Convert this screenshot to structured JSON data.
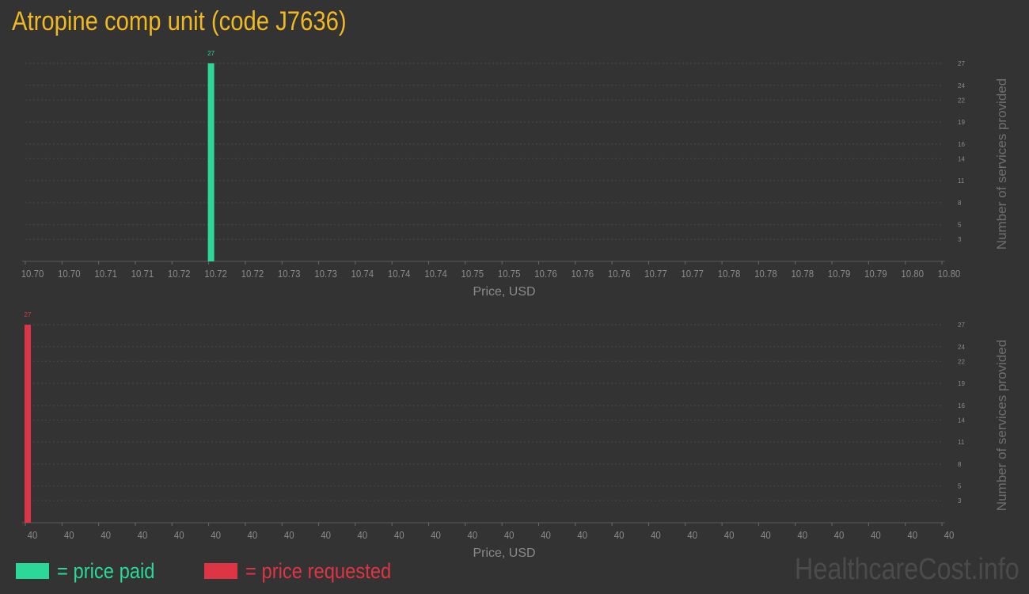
{
  "title": "Atropine comp unit (code J7636)",
  "colors": {
    "paid": "#2bd897",
    "requested": "#de3545",
    "title": "#f0b822",
    "grid": "#4a4a4a",
    "axis_text": "#8a8a8a",
    "background": "#333333"
  },
  "chart_data": [
    {
      "type": "bar",
      "name": "price paid chart",
      "categories": [
        "10.70",
        "10.70",
        "10.71",
        "10.71",
        "10.72",
        "10.72",
        "10.72",
        "10.73",
        "10.73",
        "10.74",
        "10.74",
        "10.74",
        "10.75",
        "10.75",
        "10.76",
        "10.76",
        "10.76",
        "10.77",
        "10.77",
        "10.78",
        "10.78",
        "10.78",
        "10.79",
        "10.79",
        "10.80",
        "10.80"
      ],
      "values": [
        0,
        0,
        0,
        0,
        0,
        27,
        0,
        0,
        0,
        0,
        0,
        0,
        0,
        0,
        0,
        0,
        0,
        0,
        0,
        0,
        0,
        0,
        0,
        0,
        0,
        0
      ],
      "data_labels": [
        {
          "index": 5,
          "text": "27"
        }
      ],
      "yticks": [
        "3",
        "5",
        "8",
        "11",
        "14",
        "16",
        "19",
        "22",
        "24",
        "27"
      ],
      "ytick_values": [
        3,
        5,
        8,
        11,
        14,
        16,
        19,
        22,
        24,
        27
      ],
      "ylim": [
        0,
        27
      ],
      "xlabel": "Price, USD",
      "ylabel": "Number of services provided",
      "color": "#2bd897",
      "grid": true
    },
    {
      "type": "bar",
      "name": "price requested chart",
      "categories": [
        "40",
        "40",
        "40",
        "40",
        "40",
        "40",
        "40",
        "40",
        "40",
        "40",
        "40",
        "40",
        "40",
        "40",
        "40",
        "40",
        "40",
        "40",
        "40",
        "40",
        "40",
        "40",
        "40",
        "40",
        "40",
        "40"
      ],
      "values": [
        27,
        0,
        0,
        0,
        0,
        0,
        0,
        0,
        0,
        0,
        0,
        0,
        0,
        0,
        0,
        0,
        0,
        0,
        0,
        0,
        0,
        0,
        0,
        0,
        0,
        0
      ],
      "data_labels": [
        {
          "index": 0,
          "text": "27"
        }
      ],
      "yticks": [
        "3",
        "5",
        "8",
        "11",
        "14",
        "16",
        "19",
        "22",
        "24",
        "27"
      ],
      "ytick_values": [
        3,
        5,
        8,
        11,
        14,
        16,
        19,
        22,
        24,
        27
      ],
      "ylim": [
        0,
        27
      ],
      "xlabel": "Price, USD",
      "ylabel": "Number of services provided",
      "color": "#de3545",
      "grid": true
    }
  ],
  "legend": {
    "paid_label": "= price paid",
    "requested_label": "= price requested"
  },
  "watermark": "HealthcareCost.info"
}
